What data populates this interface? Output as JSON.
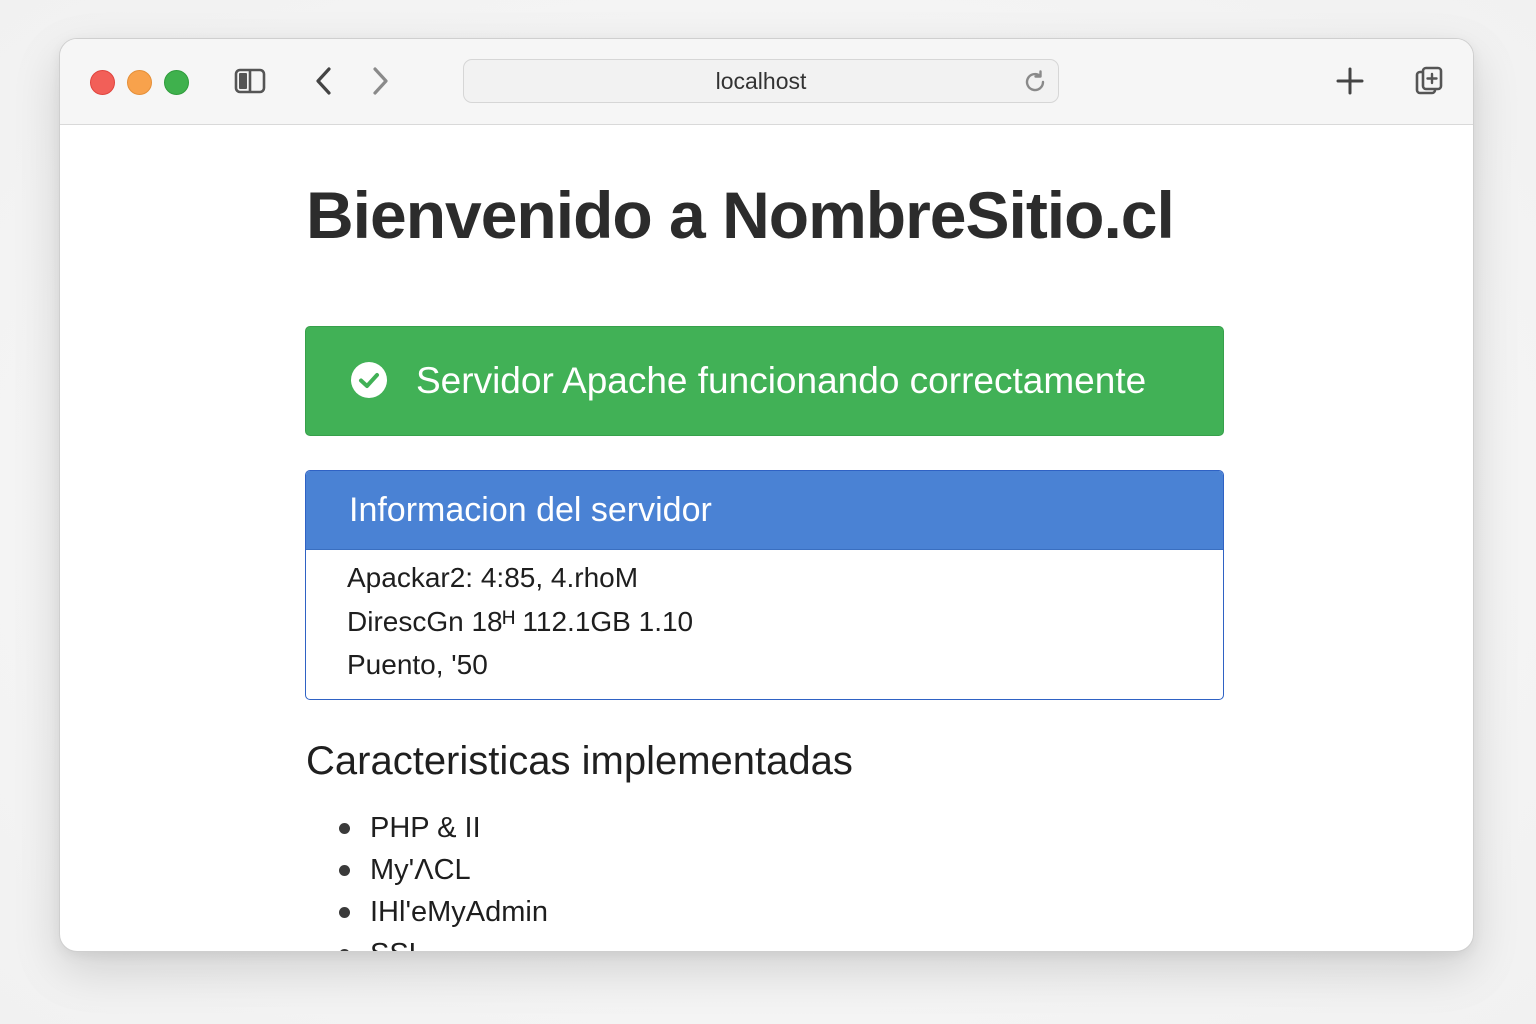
{
  "browser": {
    "address": "localhost",
    "icons": {
      "sidebar": "sidebar-icon",
      "back": "chevron-left-icon",
      "forward": "chevron-right-icon",
      "reload": "reload-icon",
      "new_tab": "plus-icon",
      "tabs": "tab-overview-icon"
    }
  },
  "page": {
    "title": "Bienvenido a NombreSitio.cl",
    "alert": {
      "icon": "check-circle-icon",
      "text": "Servidor Apache funcionando correctamente",
      "color": "#41b156"
    },
    "server_panel": {
      "title": "Informacion del servidor",
      "header_color": "#4a82d4",
      "lines": [
        "Apackar2: 4:85, 4.rhoM",
        "DirescGn 18ᴴ 112.1GB 1.10",
        "Puento, '50"
      ]
    },
    "features": {
      "title": "Caracteristicas implementadas",
      "items": [
        "PHP & II",
        "My'ΛCL",
        "IHl'eMyAdmin",
        "SSL"
      ]
    }
  }
}
